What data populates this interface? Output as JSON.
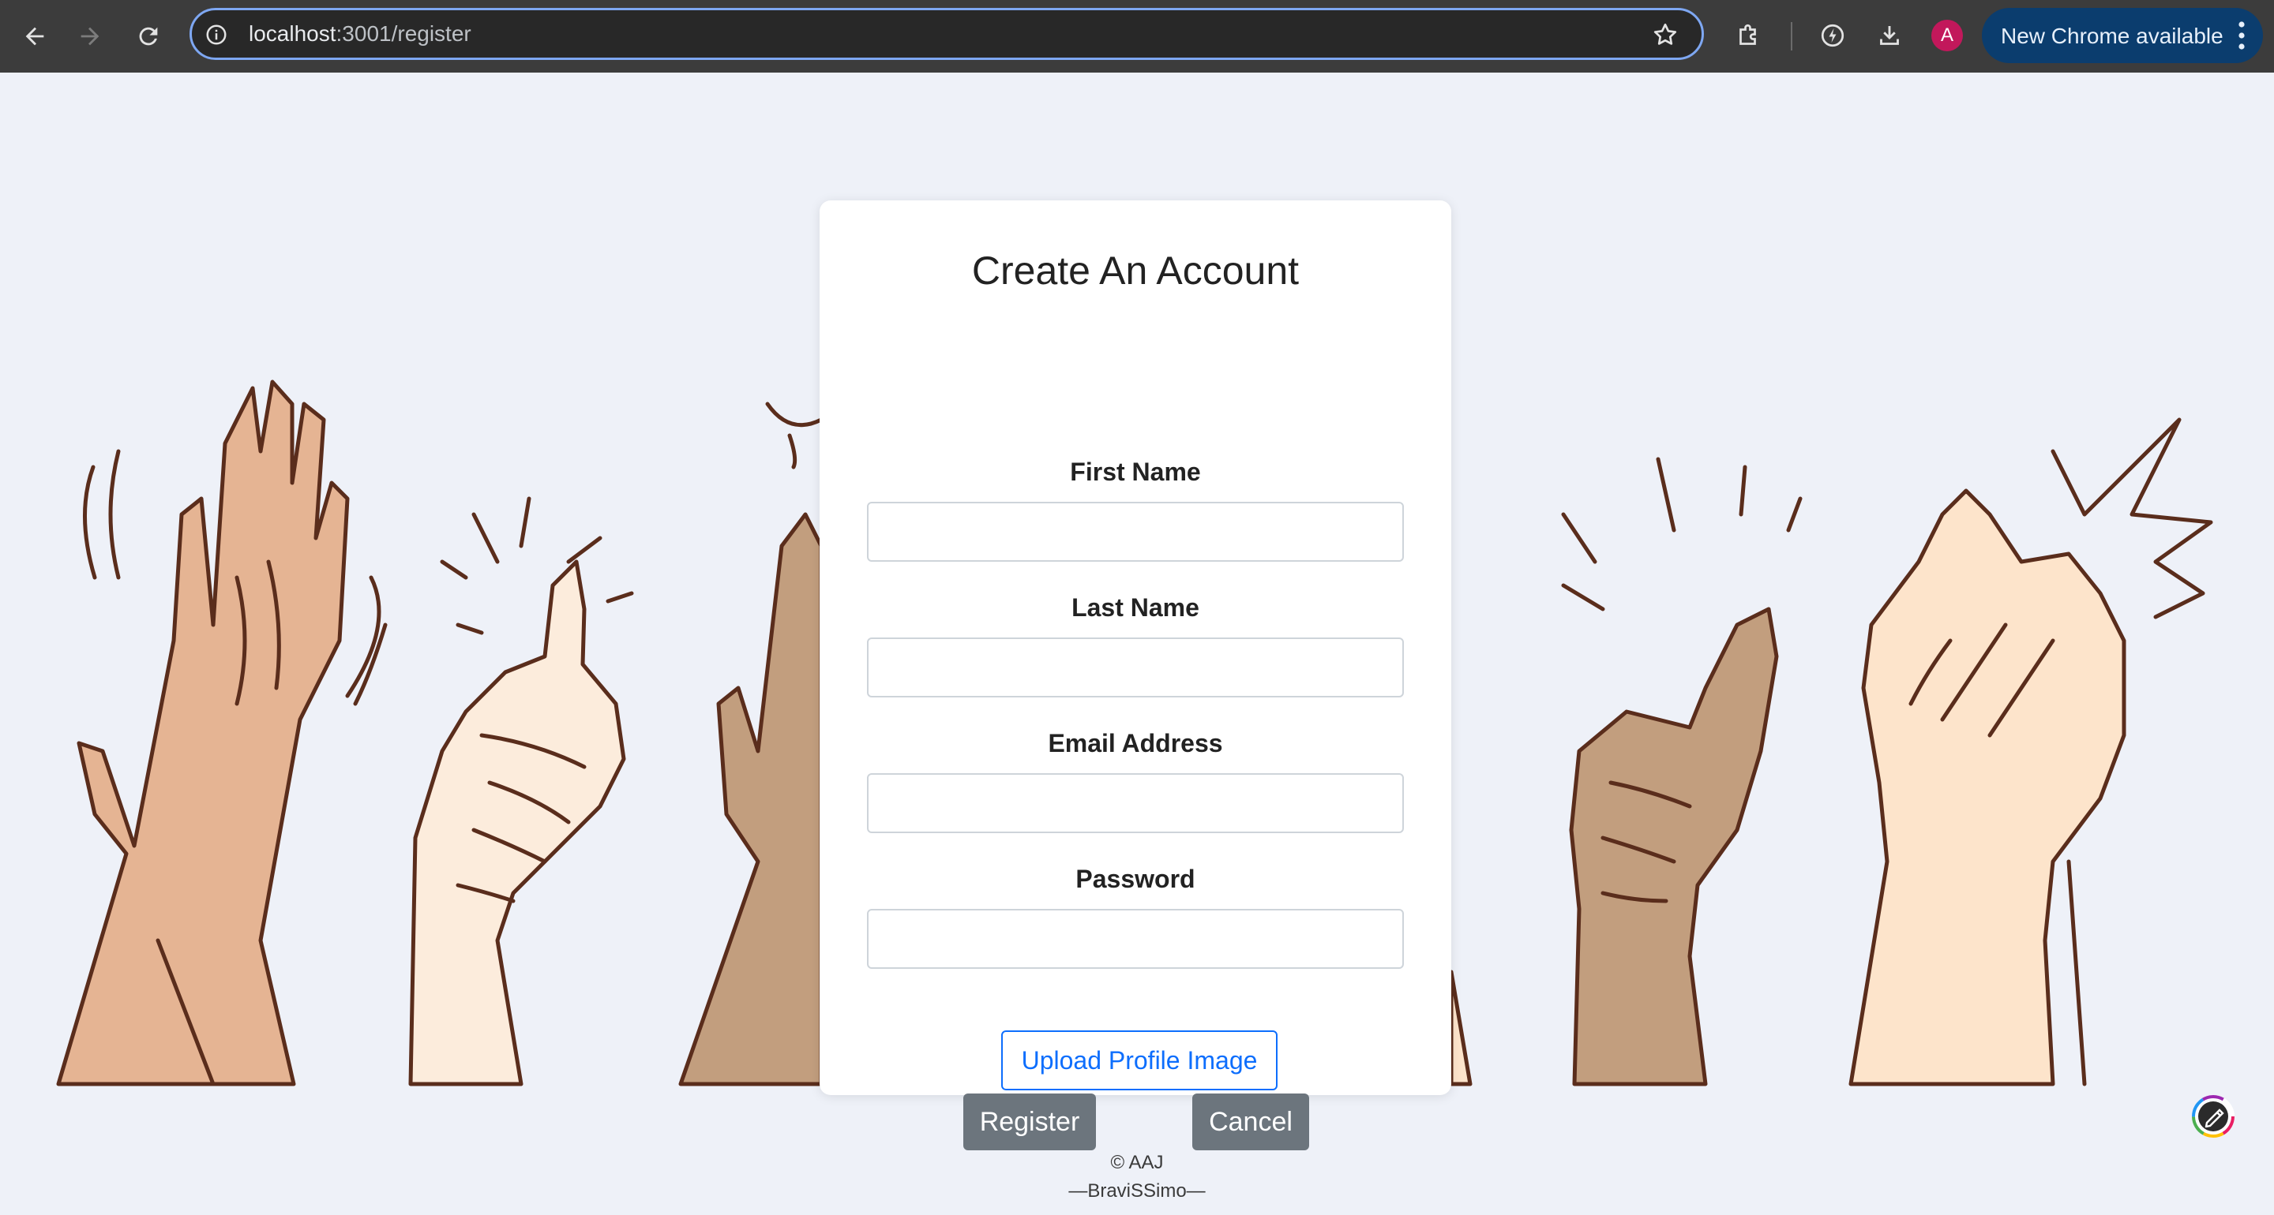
{
  "browser": {
    "url_host": "localhost",
    "url_path": ":3001/register",
    "profile_initial": "A",
    "update_label": "New Chrome available",
    "icons": [
      "back-arrow-icon",
      "forward-arrow-icon",
      "reload-icon",
      "site-info-icon",
      "bookmark-star-icon",
      "extensions-puzzle-icon",
      "performance-icon",
      "download-icon",
      "more-vert-icon"
    ],
    "accent": "#7ea7f2"
  },
  "form": {
    "title": "Create An Account",
    "fields": [
      {
        "label": "First Name",
        "value": "",
        "placeholder": ""
      },
      {
        "label": "Last Name",
        "value": "",
        "placeholder": ""
      },
      {
        "label": "Email Address",
        "value": "",
        "placeholder": ""
      },
      {
        "label": "Password",
        "value": "",
        "placeholder": ""
      }
    ],
    "upload_label": "Upload Profile Image",
    "register_label": "Register",
    "cancel_label": "Cancel",
    "primary_color": "#0d6efd",
    "secondary_color": "#6c757d"
  },
  "footer": {
    "copyright": "© AAJ",
    "tagline": "—BraviSSimo—"
  },
  "colors": {
    "page_bg": "#eef1f8",
    "skin_tones": [
      "#e5b493",
      "#fcecdc",
      "#c29e7e",
      "#c29e7e",
      "#fde4cb"
    ],
    "outline": "#5a2d1c"
  }
}
